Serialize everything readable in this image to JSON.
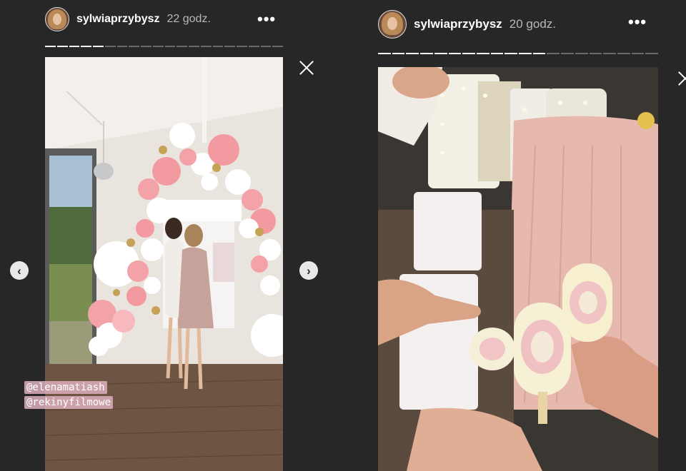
{
  "stories": [
    {
      "username": "sylwiaprzybysz",
      "time": "22 godz.",
      "progress": {
        "total": 20,
        "completed": 5
      },
      "mentions": [
        "@elenamatiash",
        "@rekinyfilmowe"
      ]
    },
    {
      "username": "sylwiaprzybysz",
      "time": "20 godz.",
      "progress": {
        "total": 20,
        "completed": 12
      }
    }
  ],
  "controls": {
    "more_glyph": "•••",
    "prev_glyph": "‹",
    "next_glyph": "›"
  },
  "colors": {
    "background": "#272727",
    "progress_done": "#f2f2f2",
    "progress_pending": "#6b6b6b"
  }
}
